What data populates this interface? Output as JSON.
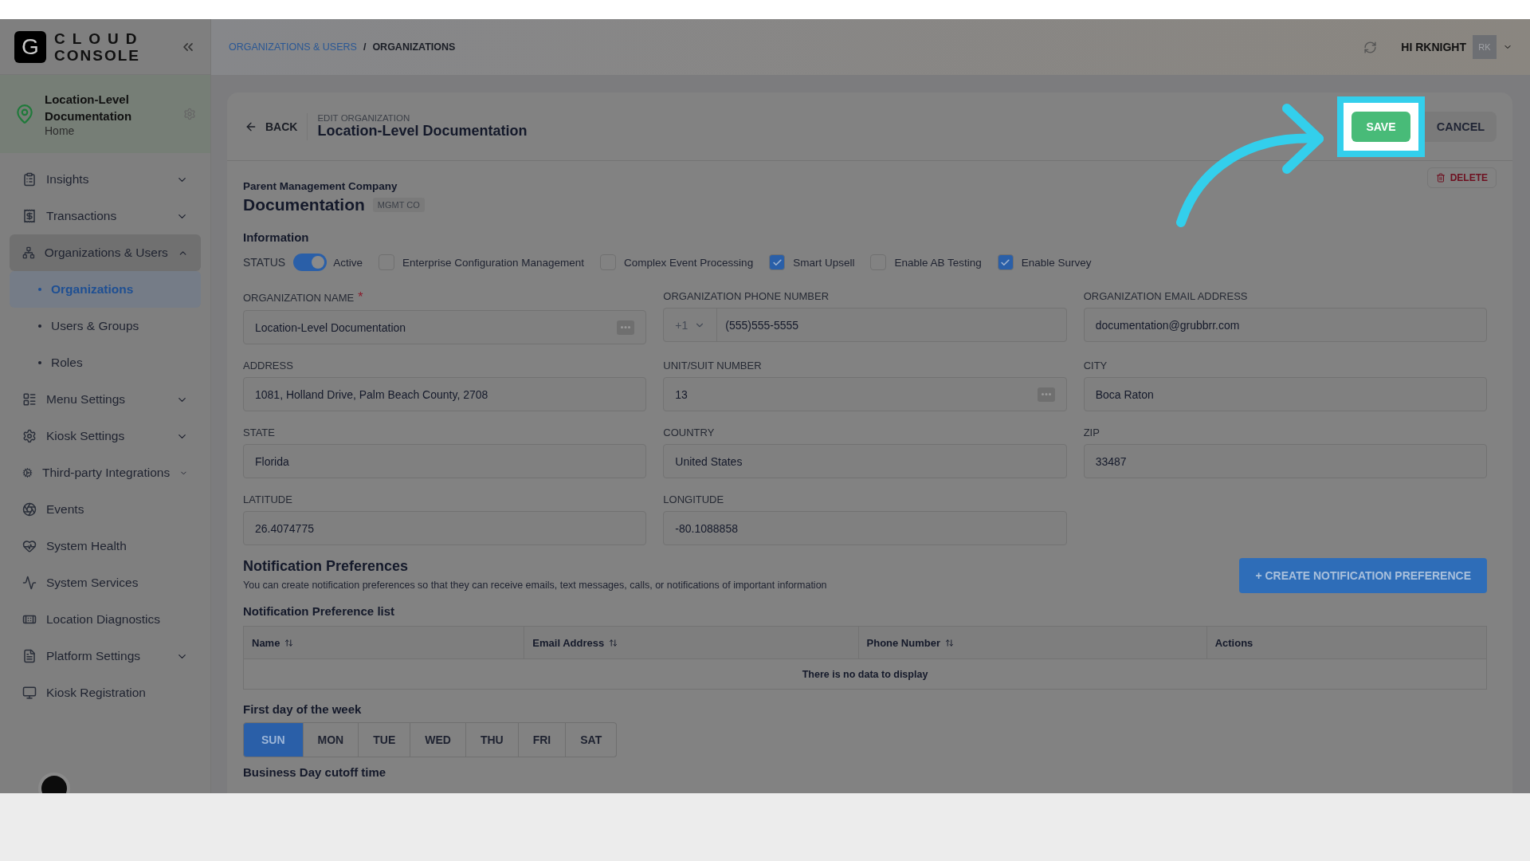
{
  "brand": {
    "letter": "G",
    "line1": "CLOUD",
    "line2": "CONSOLE"
  },
  "location": {
    "name": "Location-Level Documentation",
    "subtitle": "Home"
  },
  "nav": [
    {
      "label": "Insights",
      "expanded": false,
      "selected": false
    },
    {
      "label": "Transactions",
      "expanded": false,
      "selected": false
    },
    {
      "label": "Organizations & Users",
      "expanded": true,
      "selected": true,
      "children": [
        {
          "label": "Organizations",
          "selected": true
        },
        {
          "label": "Users & Groups",
          "selected": false
        },
        {
          "label": "Roles",
          "selected": false
        }
      ]
    },
    {
      "label": "Menu Settings",
      "expanded": false,
      "selected": false
    },
    {
      "label": "Kiosk Settings",
      "expanded": false,
      "selected": false
    },
    {
      "label": "Third-party Integrations",
      "expanded": false,
      "selected": false
    },
    {
      "label": "Events",
      "selected": false
    },
    {
      "label": "System Health",
      "selected": false
    },
    {
      "label": "System Services",
      "selected": false
    },
    {
      "label": "Location Diagnostics",
      "selected": false
    },
    {
      "label": "Platform Settings",
      "expanded": false,
      "selected": false
    },
    {
      "label": "Kiosk Registration",
      "selected": false
    }
  ],
  "breadcrumb": [
    {
      "label": "ORGANIZATIONS & USERS",
      "kind": "link"
    },
    {
      "label": "/",
      "kind": "separator"
    },
    {
      "label": "ORGANIZATIONS",
      "kind": "current"
    }
  ],
  "user": {
    "greeting": "HI RKNIGHT",
    "initials": "RK"
  },
  "header": {
    "back": "BACK",
    "overline": "EDIT ORGANIZATION",
    "title": "Location-Level Documentation",
    "save": "SAVE",
    "cancel": "CANCEL",
    "delete": "DELETE"
  },
  "parent": {
    "label": "Parent Management Company",
    "name": "Documentation",
    "tag": "MGMT CO"
  },
  "information": {
    "title": "Information",
    "status_label": "STATUS",
    "options": [
      {
        "kind": "switch",
        "label": "Active",
        "on": true
      },
      {
        "kind": "checkbox",
        "label": "Enterprise Configuration Management",
        "checked": false
      },
      {
        "kind": "checkbox",
        "label": "Complex Event Processing",
        "checked": false
      },
      {
        "kind": "checkbox",
        "label": "Smart Upsell",
        "checked": true
      },
      {
        "kind": "checkbox",
        "label": "Enable AB Testing",
        "checked": false
      },
      {
        "kind": "checkbox",
        "label": "Enable Survey",
        "checked": true
      }
    ]
  },
  "fields": [
    {
      "label": "ORGANIZATION NAME",
      "required_mark": "*",
      "value": "Location-Level Documentation",
      "kind": "dots"
    },
    {
      "label": "ORGANIZATION PHONE NUMBER",
      "value": "(555)555-5555",
      "kind": "phone",
      "prefix": "+1"
    },
    {
      "label": "ORGANIZATION EMAIL ADDRESS",
      "value": "documentation@grubbrr.com",
      "kind": "text"
    },
    {
      "label": "ADDRESS",
      "value": "1081, Holland Drive, Palm Beach County, 2708",
      "kind": "text"
    },
    {
      "label": "UNIT/SUIT NUMBER",
      "value": "13",
      "kind": "dots"
    },
    {
      "label": "CITY",
      "value": "Boca Raton",
      "kind": "text"
    },
    {
      "label": "STATE",
      "value": "Florida",
      "kind": "text"
    },
    {
      "label": "COUNTRY",
      "value": "United States",
      "kind": "text"
    },
    {
      "label": "ZIP",
      "value": "33487",
      "kind": "text"
    },
    {
      "label": "LATITUDE",
      "value": "26.4074775",
      "kind": "text"
    },
    {
      "label": "LONGITUDE",
      "value": "-80.1088858",
      "kind": "text"
    }
  ],
  "notifications": {
    "title": "Notification Preferences",
    "description": "You can create notification preferences so that they can receive emails, text messages, calls, or notifications of important information",
    "create": "+ CREATE NOTIFICATION PREFERENCE",
    "list_title": "Notification Preference list",
    "columns": [
      {
        "label": "Name",
        "sortable": true
      },
      {
        "label": "Email Address",
        "sortable": true
      },
      {
        "label": "Phone Number",
        "sortable": true
      },
      {
        "label": "Actions",
        "sortable": false
      }
    ],
    "empty": "There is no data to display"
  },
  "week": {
    "label": "First day of the week",
    "days": [
      {
        "label": "SUN",
        "selected": true
      },
      {
        "label": "MON",
        "selected": false
      },
      {
        "label": "TUE",
        "selected": false
      },
      {
        "label": "WED",
        "selected": false
      },
      {
        "label": "THU",
        "selected": false
      },
      {
        "label": "FRI",
        "selected": false
      },
      {
        "label": "SAT",
        "selected": false
      }
    ]
  },
  "cutoff": {
    "label": "Business Day cutoff time"
  }
}
